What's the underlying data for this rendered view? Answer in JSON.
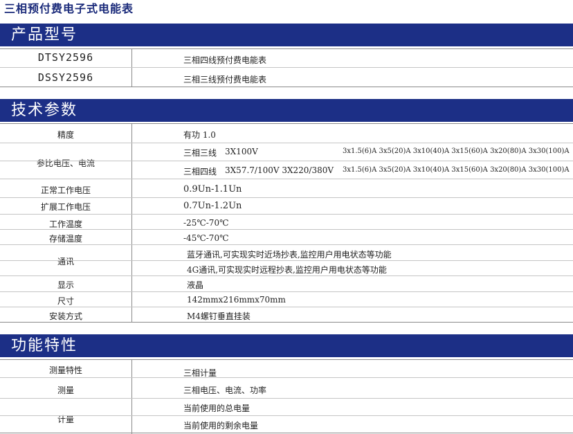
{
  "page_title": "三相预付费电子式电能表",
  "sections": {
    "models": "产品型号",
    "tech": "技术参数",
    "features": "功能特性"
  },
  "models": [
    {
      "code": "DTSY2596",
      "desc": "三相四线预付费电能表"
    },
    {
      "code": "DSSY2596",
      "desc": "三相三线预付费电能表"
    }
  ],
  "tech": {
    "accuracy": {
      "label": "精度",
      "value": "有功 1.0"
    },
    "ref": {
      "label": "参比电压、电流",
      "three_wire": {
        "name": "三相三线",
        "voltage": "3X100V",
        "currents": "3x1.5(6)A 3x5(20)A 3x10(40)A 3x15(60)A 3x20(80)A 3x30(100)A"
      },
      "four_wire": {
        "name": "三相四线",
        "voltage": "3X57.7/100V  3X220/380V",
        "currents": "3x1.5(6)A 3x5(20)A 3x10(40)A 3x15(60)A 3x20(80)A 3x30(100)A"
      }
    },
    "normal_voltage": {
      "label": "正常工作电压",
      "value": "0.9Un-1.1Un"
    },
    "extended_voltage": {
      "label": "扩展工作电压",
      "value": "0.7Un-1.2Un"
    },
    "working_temp": {
      "label": "工作温度",
      "value": "-25℃-70℃"
    },
    "storage_temp": {
      "label": "存储温度",
      "value": "-45℃-70℃"
    },
    "comm": {
      "label": "通讯",
      "bluetooth": "蓝牙通讯,可实现实时近场抄表,监控用户用电状态等功能",
      "g4": "4G通讯,可实现实时远程抄表,监控用户用电状态等功能"
    },
    "display": {
      "label": "显示",
      "value": "液晶"
    },
    "size": {
      "label": "尺寸",
      "value": "142mmx216mmx70mm"
    },
    "install": {
      "label": "安装方式",
      "value": "M4螺钉垂直挂装"
    }
  },
  "features": {
    "measure_type": {
      "label": "测量特性",
      "value": "三相计量"
    },
    "measure": {
      "label": "测量",
      "value": "三相电压、电流、功率"
    },
    "metering": {
      "label": "计量",
      "total": "当前使用的总电量",
      "remaining": "当前使用的剩余电量"
    }
  }
}
